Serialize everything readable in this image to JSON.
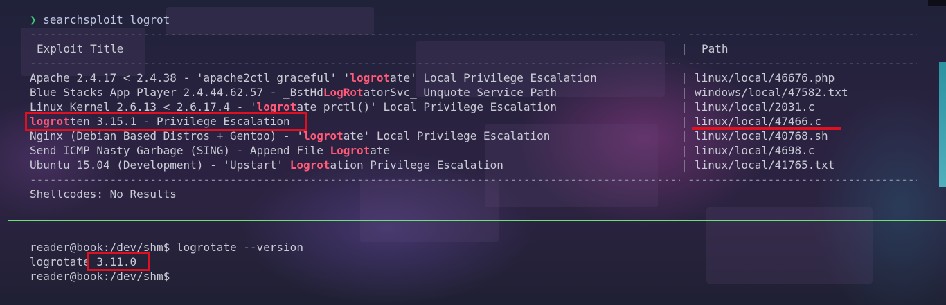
{
  "terminal": {
    "prompt_symbol": "❯",
    "command": "searchsploit logrot",
    "header": {
      "exploit_title": "Exploit Title",
      "path": "Path"
    },
    "separator": "|",
    "rows": [
      {
        "pre": "Apache 2.4.17 < 2.4.38 - 'apache2ctl graceful' '",
        "match": "logrot",
        "post": "ate' Local Privilege Escalation",
        "path": "linux/local/46676.php"
      },
      {
        "pre": "Blue Stacks App Player 2.4.44.62.57 - _BstHd",
        "match": "LogRot",
        "post": "atorSvc_ Unquote Service Path",
        "path": "windows/local/47582.txt"
      },
      {
        "pre": "Linux Kernel 2.6.13 < 2.6.17.4 - '",
        "match": "logrot",
        "post": "ate prctl()' Local Privilege Escalation",
        "path": "linux/local/2031.c"
      },
      {
        "pre": "",
        "match": "logrot",
        "post": "ten 3.15.1 - Privilege Escalation",
        "path": "linux/local/47466.c"
      },
      {
        "pre": "Nginx (Debian Based Distros + Gentoo) - '",
        "match": "logrot",
        "post": "ate' Local Privilege Escalation",
        "path": "linux/local/40768.sh"
      },
      {
        "pre": "Send ICMP Nasty Garbage (SING) - Append File ",
        "match": "Logrot",
        "post": "ate",
        "path": "linux/local/4698.c"
      },
      {
        "pre": "Ubuntu 15.04 (Development) - 'Upstart' ",
        "match": "Logrot",
        "post": "ation Privilege Escalation",
        "path": "linux/local/41765.txt"
      }
    ],
    "shellcodes": "Shellcodes: No Results",
    "session": [
      "reader@book:/dev/shm$ logrotate --version",
      "logrotate 3.11.0",
      "reader@book:/dev/shm$"
    ]
  },
  "colors": {
    "highlight": "#ff5a78",
    "prompt": "#3fd07c",
    "annotation": "#e01020",
    "divider": "#6ee07a"
  }
}
